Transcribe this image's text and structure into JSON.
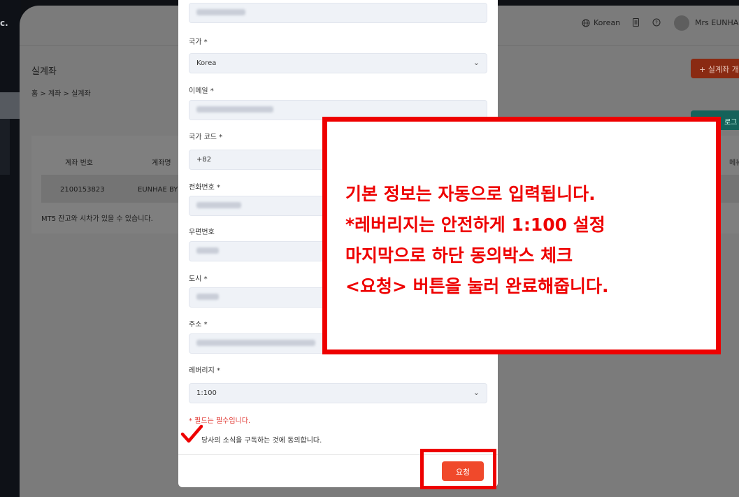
{
  "sidebar": {
    "brand": "c."
  },
  "topbar": {
    "language": "Korean",
    "user_name": "Mrs EUNHAE"
  },
  "page": {
    "title": "실계좌",
    "breadcrumb": "홈 > 계좌 > 실계좌",
    "add_button": "+ 실계좌 개",
    "teal_button": "로그"
  },
  "table": {
    "headers": [
      "계좌 번호",
      "계좌명",
      "메뉴"
    ],
    "row": [
      "2100153823",
      "EUNHAE BYUN"
    ],
    "note": "MT5 잔고와 시차가 있을 수 있습니다."
  },
  "form": {
    "country_label": "국가 *",
    "country_value": "Korea",
    "email_label": "이메일 *",
    "country_code_label": "국가 코드 *",
    "country_code_value": "+82",
    "phone_label": "전화번호 *",
    "postal_label": "우편번호",
    "city_label": "도시 *",
    "address_label": "주소 *",
    "leverage_label": "레버리지 *",
    "leverage_value": "1:100",
    "required_note": "* 필드는 필수입니다.",
    "agree_text": "당사의 소식을 구독하는 것에 동의합니다.",
    "request_button": "요청"
  },
  "annotation": {
    "lines": [
      "기본 정보는 자동으로 입력됩니다.",
      "*레버리지는 안전하게 1:100 설정",
      "마지막으로 하단 동의박스 체크",
      "<요청> 버튼을 눌러 완료해줍니다."
    ],
    "color": "#ee0000"
  }
}
